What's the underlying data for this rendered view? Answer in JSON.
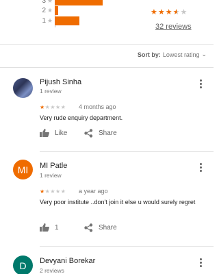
{
  "rating_bars": [
    {
      "label": "3",
      "value": 70
    },
    {
      "label": "2",
      "value": 5
    },
    {
      "label": "1",
      "value": 36
    }
  ],
  "summary": {
    "stars_filled": 3,
    "stars_half": 1,
    "stars_total": 5,
    "reviews_link": "32 reviews"
  },
  "sort": {
    "label": "Sort by:",
    "value": "Lowest rating"
  },
  "reviews": [
    {
      "name": "Pijush Sinha",
      "count": "1 review",
      "avatar_letter": "",
      "rating": 1,
      "date": "4 months ago",
      "text": "Very rude enquiry department.",
      "like_label": "Like",
      "share_label": "Share"
    },
    {
      "name": "MI Patle",
      "count": "1 review",
      "avatar_letter": "MI",
      "rating": 1,
      "date": "a year ago",
      "text": "Very poor institute ..don't join it else u would surely regret",
      "like_label": "1",
      "share_label": "Share"
    },
    {
      "name": "Devyani Borekar",
      "count": "2 reviews",
      "avatar_letter": "D"
    }
  ],
  "colors": {
    "accent": "#ef6c00",
    "teal": "#00796b"
  }
}
